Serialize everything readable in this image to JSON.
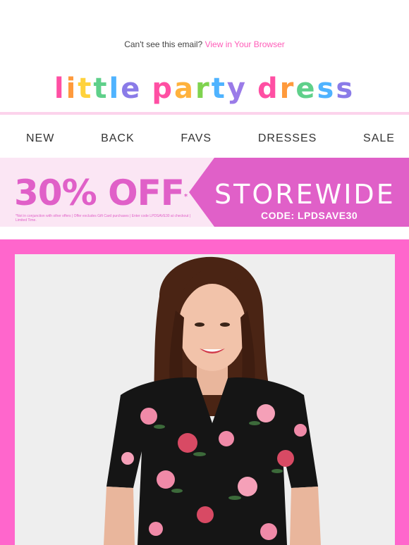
{
  "preheader": {
    "text": "Can't see this email?",
    "link": "View in Your Browser"
  },
  "logo": {
    "word1": [
      "l",
      "i",
      "t",
      "t",
      "l",
      "e"
    ],
    "word2": [
      "p",
      "a",
      "r",
      "t",
      "y"
    ],
    "word3": [
      "d",
      "r",
      "e",
      "s",
      "s"
    ],
    "colors": [
      "#ff4fa3",
      "#ff9a3c",
      "#ffd23c",
      "#5fd08a",
      "#4fb3ff",
      "#8a7be8",
      "#ff4fa3",
      "#ffb23c",
      "#7fd34f",
      "#4fb3ff",
      "#9a7be8",
      "#ff4fa3",
      "#ff9a3c",
      "#5fd08a",
      "#4fb3ff",
      "#8a7be8"
    ]
  },
  "nav": {
    "items": [
      "NEW",
      "BACK",
      "FAVS",
      "DRESSES",
      "SALE"
    ]
  },
  "banner": {
    "discount": "30% OFF",
    "asterisk": "*",
    "fine_print": "*Not in conjunction with other offers | Offer excludes Gift Card purchases | Enter code LPDSAVE30 at checkout | Limited Time.",
    "headline": "STOREWIDE",
    "code": "CODE: LPDSAVE30",
    "accent_color": "#e060c8"
  },
  "hero": {
    "frame_color": "#ff66cc",
    "dress_print": "black floral"
  }
}
